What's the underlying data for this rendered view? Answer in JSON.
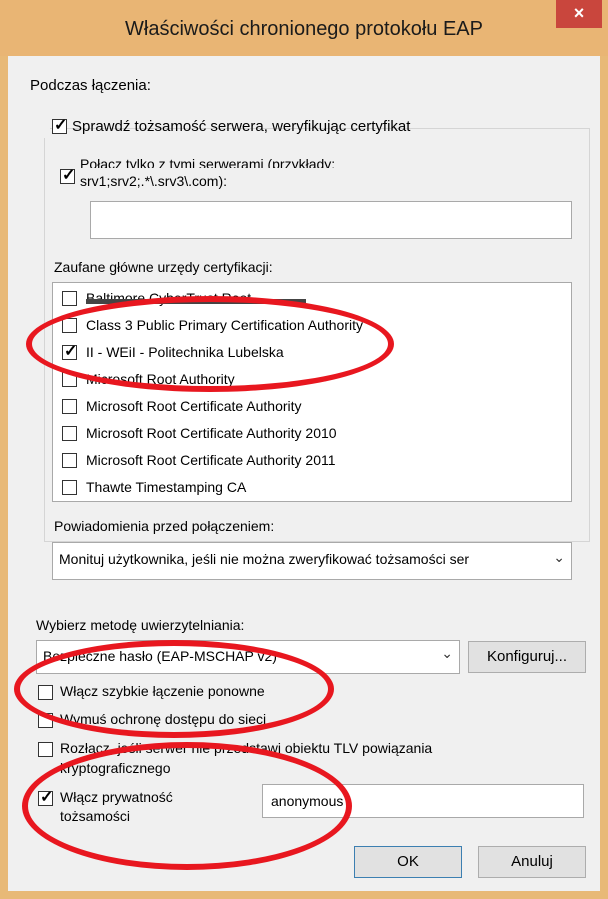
{
  "window": {
    "title": "Właściwości chronionego protokołu EAP",
    "close_label": "×"
  },
  "connect": {
    "section_label": "Podczas łączenia:",
    "verify_server_label": "Sprawdź tożsamość serwera, weryfikując certyfikat",
    "verify_server_checked": true,
    "connect_servers_label_line1": "Połącz tylko z tymi serwerami (przykłady:",
    "connect_servers_label_line2": "srv1;srv2;.*\\.srv3\\.com):",
    "connect_servers_checked": true,
    "servers_value": ""
  },
  "trusted": {
    "label": "Zaufane główne urzędy certyfikacji:",
    "items": [
      {
        "label": "Baltimore CyberTrust Root",
        "checked": false
      },
      {
        "label": "Class 3 Public Primary Certification Authority",
        "checked": false
      },
      {
        "label": "II - WEiI - Politechnika Lubelska",
        "checked": true
      },
      {
        "label": "Microsoft Root Authority",
        "checked": false
      },
      {
        "label": "Microsoft Root Certificate Authority",
        "checked": false
      },
      {
        "label": "Microsoft Root Certificate Authority 2010",
        "checked": false
      },
      {
        "label": "Microsoft Root Certificate Authority 2011",
        "checked": false
      },
      {
        "label": "Thawte Timestamping CA",
        "checked": false
      }
    ]
  },
  "notifications": {
    "label": "Powiadomienia przed połączeniem:",
    "value": "Monituj użytkownika, jeśli nie można zweryfikować tożsamości ser"
  },
  "auth": {
    "label": "Wybierz metodę uwierzytelniania:",
    "value": "Bezpieczne hasło (EAP-MSCHAP v2)",
    "configure_label": "Konfiguruj..."
  },
  "options": {
    "fast_reconnect_label": "Włącz szybkie łączenie ponowne",
    "fast_reconnect_checked": false,
    "nap_label": "Wymuś ochronę dostępu do sieci",
    "nap_checked": false,
    "tlv_label_line1": "Rozłącz, jeśli serwer nie przedstawi obiektu TLV powiązania",
    "tlv_label_line2": "kryptograficznego",
    "tlv_checked": false,
    "privacy_label_line1": "Włącz prywatność",
    "privacy_label_line2": "tożsamości",
    "privacy_checked": true,
    "privacy_value": "anonymous"
  },
  "buttons": {
    "ok_label": "OK",
    "cancel_label": "Anuluj"
  },
  "colors": {
    "annotation": "#e8171f",
    "titlebar": "#e9b574",
    "close": "#c9463d"
  }
}
